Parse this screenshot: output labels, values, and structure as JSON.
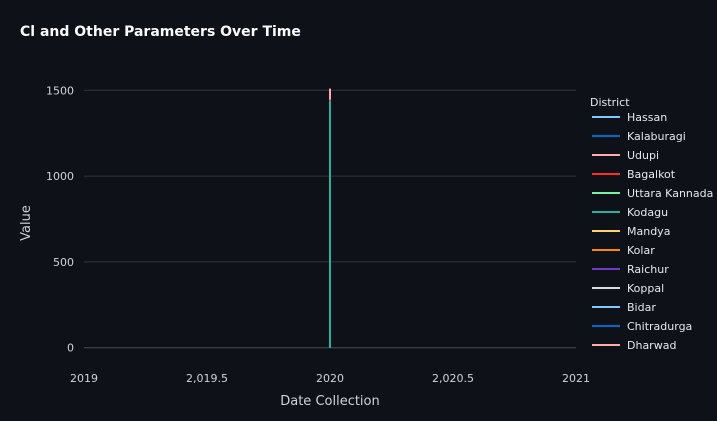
{
  "chart_data": {
    "type": "line",
    "title": "Cl and Other Parameters Over Time",
    "xlabel": "Date Collection",
    "ylabel": "Value",
    "xlim": [
      2019,
      2021
    ],
    "ylim": [
      -60,
      1560
    ],
    "x_ticks": [
      2019,
      2019.5,
      2020,
      2020.5,
      2021
    ],
    "x_tick_labels": [
      "2019",
      "2,019.5",
      "2020",
      "2,020.5",
      "2021"
    ],
    "y_ticks": [
      0,
      500,
      1000,
      1500
    ],
    "y_tick_labels": [
      "0",
      "500",
      "1000",
      "1500"
    ],
    "grid": true,
    "legend_title": "District",
    "legend_position": "right",
    "series": [
      {
        "name": "Hassan",
        "color": "#83c9ff",
        "x": [
          2020,
          2020
        ],
        "y": [
          0,
          0
        ]
      },
      {
        "name": "Kalaburagi",
        "color": "#0068c9",
        "x": [
          2020,
          2020
        ],
        "y": [
          0,
          0
        ]
      },
      {
        "name": "Udupi",
        "color": "#ffabab",
        "x": [
          2020,
          2020
        ],
        "y": [
          1440,
          1510
        ]
      },
      {
        "name": "Bagalkot",
        "color": "#ff2b2b",
        "x": [
          2020,
          2020
        ],
        "y": [
          1430,
          1445
        ]
      },
      {
        "name": "Uttara Kannada",
        "color": "#7defa1",
        "x": [
          2020,
          2020
        ],
        "y": [
          0,
          1420
        ]
      },
      {
        "name": "Kodagu",
        "color": "#29b09d",
        "x": [
          2020,
          2020
        ],
        "y": [
          0,
          1440
        ]
      },
      {
        "name": "Mandya",
        "color": "#ffd16a",
        "x": [
          2020,
          2020
        ],
        "y": [
          0,
          0
        ]
      },
      {
        "name": "Kolar",
        "color": "#ff8700",
        "x": [
          2020,
          2020
        ],
        "y": [
          0,
          0
        ]
      },
      {
        "name": "Raichur",
        "color": "#6d3fc0",
        "x": [
          2020,
          2020
        ],
        "y": [
          0,
          0
        ]
      },
      {
        "name": "Koppal",
        "color": "#d5dae5",
        "x": [
          2020,
          2020
        ],
        "y": [
          0,
          0
        ]
      },
      {
        "name": "Bidar",
        "color": "#83c9ff",
        "x": [
          2020,
          2020
        ],
        "y": [
          0,
          0
        ]
      },
      {
        "name": "Chitradurga",
        "color": "#0068c9",
        "x": [
          2020,
          2020
        ],
        "y": [
          0,
          0
        ]
      },
      {
        "name": "Dharwad",
        "color": "#ffabab",
        "x": [
          2020,
          2020
        ],
        "y": [
          0,
          0
        ]
      }
    ]
  }
}
